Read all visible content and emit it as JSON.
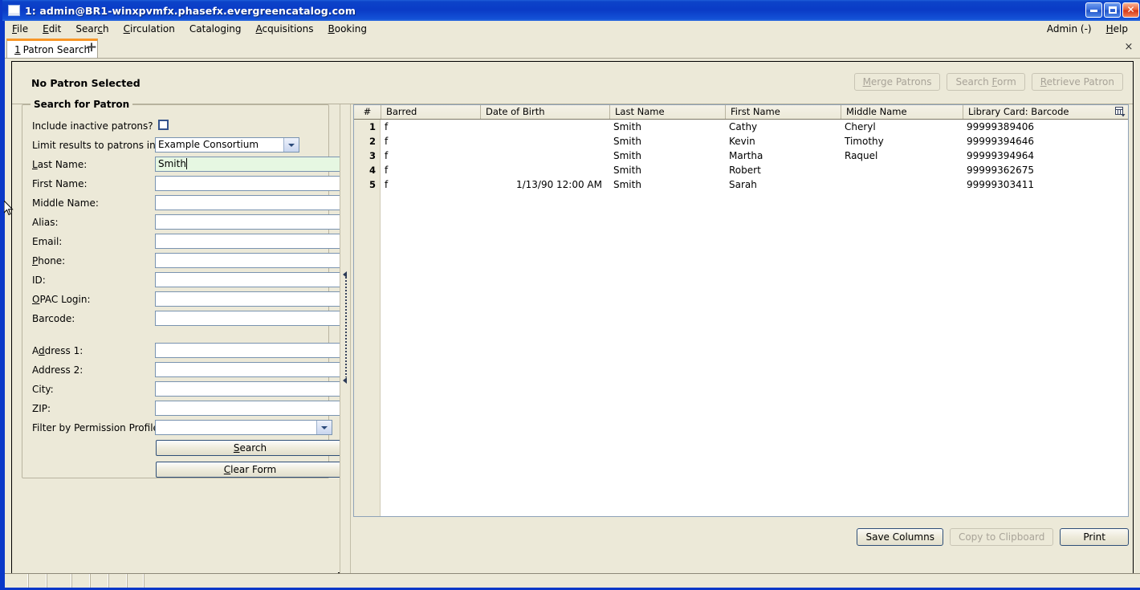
{
  "window": {
    "title": "1: admin@BR1-winxpvmfx.phasefx.evergreencatalog.com",
    "icon": "app-window-icon",
    "minimize": "_",
    "maximize": "□",
    "close": "✕"
  },
  "menubar": {
    "items": [
      {
        "label": "File",
        "accel": "F"
      },
      {
        "label": "Edit",
        "accel": "E"
      },
      {
        "label": "Search",
        "accel": "c"
      },
      {
        "label": "Circulation",
        "accel": "C"
      },
      {
        "label": "Cataloging",
        "accel": "g"
      },
      {
        "label": "Acquisitions",
        "accel": "A"
      },
      {
        "label": "Booking",
        "accel": "B"
      }
    ],
    "right": [
      {
        "label": "Admin (-)",
        "accel": ""
      },
      {
        "label": "Help",
        "accel": "H"
      }
    ]
  },
  "tabs": {
    "items": [
      {
        "number": "1",
        "label": "Patron Search"
      }
    ],
    "add_label": "+",
    "close_label": "×"
  },
  "patron_header": {
    "status": "No Patron Selected",
    "buttons": [
      {
        "label": "Merge Patrons",
        "enabled": false
      },
      {
        "label": "Search Form",
        "enabled": false
      },
      {
        "label": "Retrieve Patron",
        "enabled": false
      }
    ]
  },
  "search_form": {
    "legend": "Search for Patron",
    "include_inactive_label": "Include inactive patrons?",
    "include_inactive_checked": false,
    "limit_label": "Limit results to patrons in",
    "limit_value": "Example Consortium",
    "fields": [
      {
        "label": "Last Name:",
        "value": "Smith",
        "focused": true
      },
      {
        "label": "First Name:",
        "value": "",
        "focused": false
      },
      {
        "label": "Middle Name:",
        "value": "",
        "focused": false
      },
      {
        "label": "Alias:",
        "value": "",
        "focused": false
      },
      {
        "label": "Email:",
        "value": "",
        "focused": false
      },
      {
        "label": "Phone:",
        "value": "",
        "focused": false
      },
      {
        "label": "ID:",
        "value": "",
        "focused": false
      },
      {
        "label": "OPAC Login:",
        "value": "",
        "focused": false
      },
      {
        "label": "Barcode:",
        "value": "",
        "focused": false
      }
    ],
    "address_fields": [
      {
        "label": "Address 1:",
        "value": ""
      },
      {
        "label": "Address 2:",
        "value": ""
      },
      {
        "label": "City:",
        "value": ""
      },
      {
        "label": "ZIP:",
        "value": ""
      }
    ],
    "permission_label": "Filter by Permission Profile:",
    "permission_value": "",
    "search_button": "Search",
    "clear_button": "Clear Form"
  },
  "results": {
    "columns": [
      {
        "key": "num",
        "label": "#"
      },
      {
        "key": "barred",
        "label": "Barred"
      },
      {
        "key": "dob",
        "label": "Date of Birth"
      },
      {
        "key": "last",
        "label": "Last Name"
      },
      {
        "key": "first",
        "label": "First Name"
      },
      {
        "key": "middle",
        "label": "Middle Name"
      },
      {
        "key": "barcode",
        "label": "Library Card: Barcode"
      }
    ],
    "rows": [
      {
        "num": "1",
        "barred": "f",
        "dob": "",
        "last": "Smith",
        "first": "Cathy",
        "middle": "Cheryl",
        "barcode": "99999389406"
      },
      {
        "num": "2",
        "barred": "f",
        "dob": "",
        "last": "Smith",
        "first": "Kevin",
        "middle": "Timothy",
        "barcode": "99999394646"
      },
      {
        "num": "3",
        "barred": "f",
        "dob": "",
        "last": "Smith",
        "first": "Martha",
        "middle": "Raquel",
        "barcode": "99999394964"
      },
      {
        "num": "4",
        "barred": "f",
        "dob": "",
        "last": "Smith",
        "first": "Robert",
        "middle": "",
        "barcode": "99999362675"
      },
      {
        "num": "5",
        "barred": "f",
        "dob": "1/13/90 12:00 AM",
        "last": "Smith",
        "first": "Sarah",
        "middle": "",
        "barcode": "99999303411"
      }
    ],
    "column_picker_icon": "column-picker-icon",
    "footer_buttons": [
      {
        "label": "Save Columns",
        "enabled": true
      },
      {
        "label": "Copy to Clipboard",
        "enabled": false
      },
      {
        "label": "Print",
        "enabled": true
      }
    ]
  },
  "statusbar": {
    "segments": [
      "",
      "",
      "",
      "",
      "",
      "",
      ""
    ]
  },
  "colors": {
    "titlebar_blue": "#0a3bc6",
    "face": "#ece9d8",
    "tab_accent": "#f79626",
    "focus_field": "#e6f7e2",
    "field_border": "#7993b0"
  }
}
